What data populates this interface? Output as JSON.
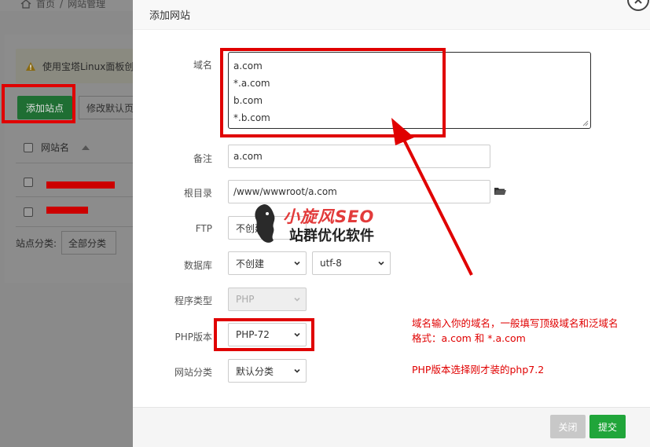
{
  "background": {
    "breadcrumb": {
      "home": "首页",
      "sep": "/",
      "current": "网站管理"
    },
    "warning_text": "使用宝塔Linux面板创",
    "add_site_button": "添加站点",
    "modify_default_button": "修改默认页",
    "table": {
      "col_site_name": "网站名"
    },
    "category_label": "站点分类:",
    "category_value": "全部分类"
  },
  "modal": {
    "title": "添加网站",
    "domain": {
      "label": "域名",
      "lines": [
        "a.com",
        "*.a.com",
        "b.com",
        "*.b.com"
      ]
    },
    "remark": {
      "label": "备注",
      "value": "a.com"
    },
    "root_dir": {
      "label": "根目录",
      "value": "/www/wwwroot/a.com",
      "icon": "folder-icon"
    },
    "ftp": {
      "label": "FTP",
      "value": "不创建"
    },
    "database": {
      "label": "数据库",
      "value": "不创建",
      "charset": "utf-8"
    },
    "program_type": {
      "label": "程序类型",
      "value": "PHP"
    },
    "php_version": {
      "label": "PHP版本",
      "value": "PHP-72"
    },
    "site_category": {
      "label": "网站分类",
      "value": "默认分类"
    },
    "close_button": "关闭",
    "submit_button": "提交"
  },
  "annotations": {
    "note_line1": "域名输入你的域名，一般填写顶级域名和泛域名",
    "note_line2": "格式：a.com 和 *.a.com",
    "note_line3": "PHP版本选择刚才装的php7.2",
    "watermark_top": "小旋风SEO",
    "watermark_bottom": "站群优化软件",
    "highlight_color": "#e00000"
  },
  "colors": {
    "accent_green": "#20a53a",
    "annotation_red": "#e00000"
  }
}
